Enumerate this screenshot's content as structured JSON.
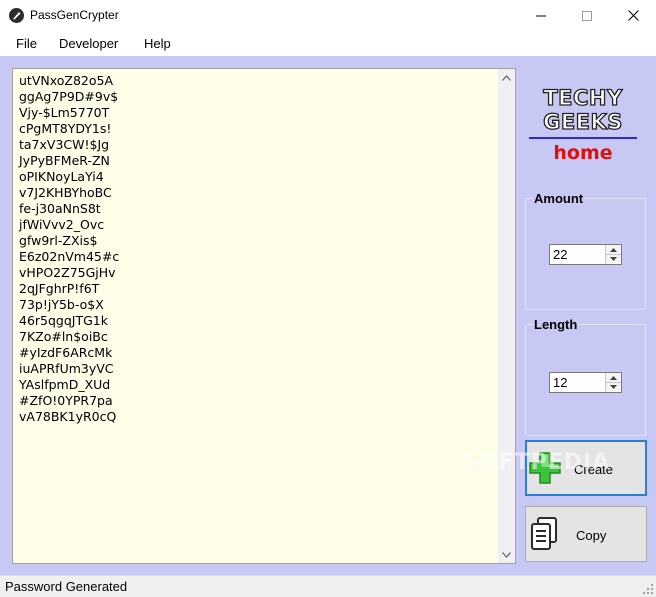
{
  "window": {
    "title": "PassGenCrypter"
  },
  "menu": {
    "file": "File",
    "developer": "Developer",
    "help": "Help"
  },
  "output": {
    "passwords": [
      "utVNxoZ82o5A",
      "ggAg7P9D#9v$",
      "Vjy-$Lm5770T",
      "cPgMT8YDY1s!",
      "ta7xV3CW!$Jg",
      "JyPyBFMeR-ZN",
      "oPIKNoyLaYi4",
      "v7J2KHBYhoBC",
      "fe-j30aNnS8t",
      "jfWiVvv2_Ovc",
      "gfw9rl-ZXis$",
      "E6z02nVm45#c",
      "vHPO2Z75GjHv",
      "2qJFghrP!f6T",
      "73p!jY5b-o$X",
      "46r5qgqJTG1k",
      "7KZo#ln$oiBc",
      "#yIzdF6ARcMk",
      "iuAPRfUm3yVC",
      "YAslfpmD_XUd",
      "#ZfO!0YPR7pa",
      "vA78BK1yR0cQ"
    ]
  },
  "logo": {
    "line1": "TECHY",
    "line2": "GEEKS",
    "line3": "home"
  },
  "amount": {
    "label": "Amount",
    "value": "22"
  },
  "length": {
    "label": "Length",
    "value": "12"
  },
  "buttons": {
    "create": "Create",
    "copy": "Copy"
  },
  "watermark": "SOFTPEDIA",
  "status": {
    "text": "Password Generated"
  },
  "colors": {
    "background": "#c8c8f4",
    "output_bg": "#fdfde8",
    "logo_home": "#e01010",
    "create_border": "#2a7fd4"
  },
  "icons": {
    "app": "app-icon",
    "create": "green-plus-icon",
    "copy": "copy-document-icon"
  }
}
